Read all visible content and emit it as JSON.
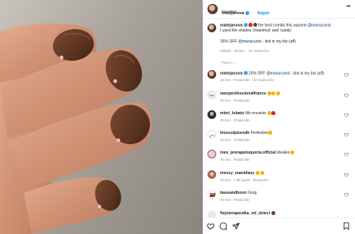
{
  "post": {
    "username": "matejanova",
    "follow_label": "Seguir",
    "location": "Barcelona",
    "caption_line1": "the best combo this autumn",
    "caption_mention": "@manucurist",
    "caption_line2": "I used the shades 'chaestnut' and 'candy'",
    "promo_prefix": "15% OFF",
    "promo_suffix": "- link in my bio (aff)",
    "caption_meta_edited": "Editado · 38 sem",
    "caption_meta_translate": "Ver traducción",
    "for_you_label": "Para ti"
  },
  "comments": [
    {
      "username": "matejanova",
      "text_prefix": "15% OFF",
      "mention": "@manucurist",
      "text_suffix": "- link in my bio (aff)",
      "meta_age": "38 sem",
      "meta_reply": "Responder",
      "meta_translate": "Ver traducción",
      "avatar_color": "#6b4332"
    },
    {
      "username": "navyprofessionalfrance",
      "text": "",
      "meta_age": "44 sem",
      "meta_reply": "Responder",
      "avatar_label": "navy",
      "avatar_color": "#f2f2f2"
    },
    {
      "username": "mimi_lobato",
      "text": "Me encanta",
      "meta_age": "46 sem",
      "meta_reply": "Responder",
      "avatar_color": "#2a2a2a"
    },
    {
      "username": "biosculpturedk",
      "text": "Perfection",
      "meta_age": "46 sem",
      "meta_reply": "Responder",
      "avatar_color": "#ffffff"
    },
    {
      "username": "ines_prerapeluqueria.official",
      "text": "Ideales",
      "meta_age": "46 sem",
      "meta_reply": "Responder",
      "avatar_color": "#d9d9d9"
    },
    {
      "username": "messy_manidiary",
      "text": "",
      "meta_age": "46 sem",
      "meta_likes": "1 Me gusta",
      "meta_reply": "Responder",
      "avatar_color": "#b98b74"
    },
    {
      "username": "baseandboon",
      "text": "Gorg",
      "meta_age": "45 sem",
      "meta_reply": "Responder",
      "avatar_label": "BASE & BOON",
      "avatar_color": "#8a3b2d"
    },
    {
      "username": "fizjoterapeutka_od_dzieci",
      "text": "",
      "meta_age": "",
      "meta_reply": "",
      "avatar_color": "#e9e9e9"
    }
  ],
  "colors": {
    "accent": "#0095f6",
    "verified": "#3897f0",
    "nail_polish": "#5b3422",
    "skin": "#d59a7c"
  },
  "icons": [
    "more-icon",
    "heart-icon",
    "comment-icon",
    "share-icon",
    "bookmark-icon",
    "verified-icon"
  ]
}
